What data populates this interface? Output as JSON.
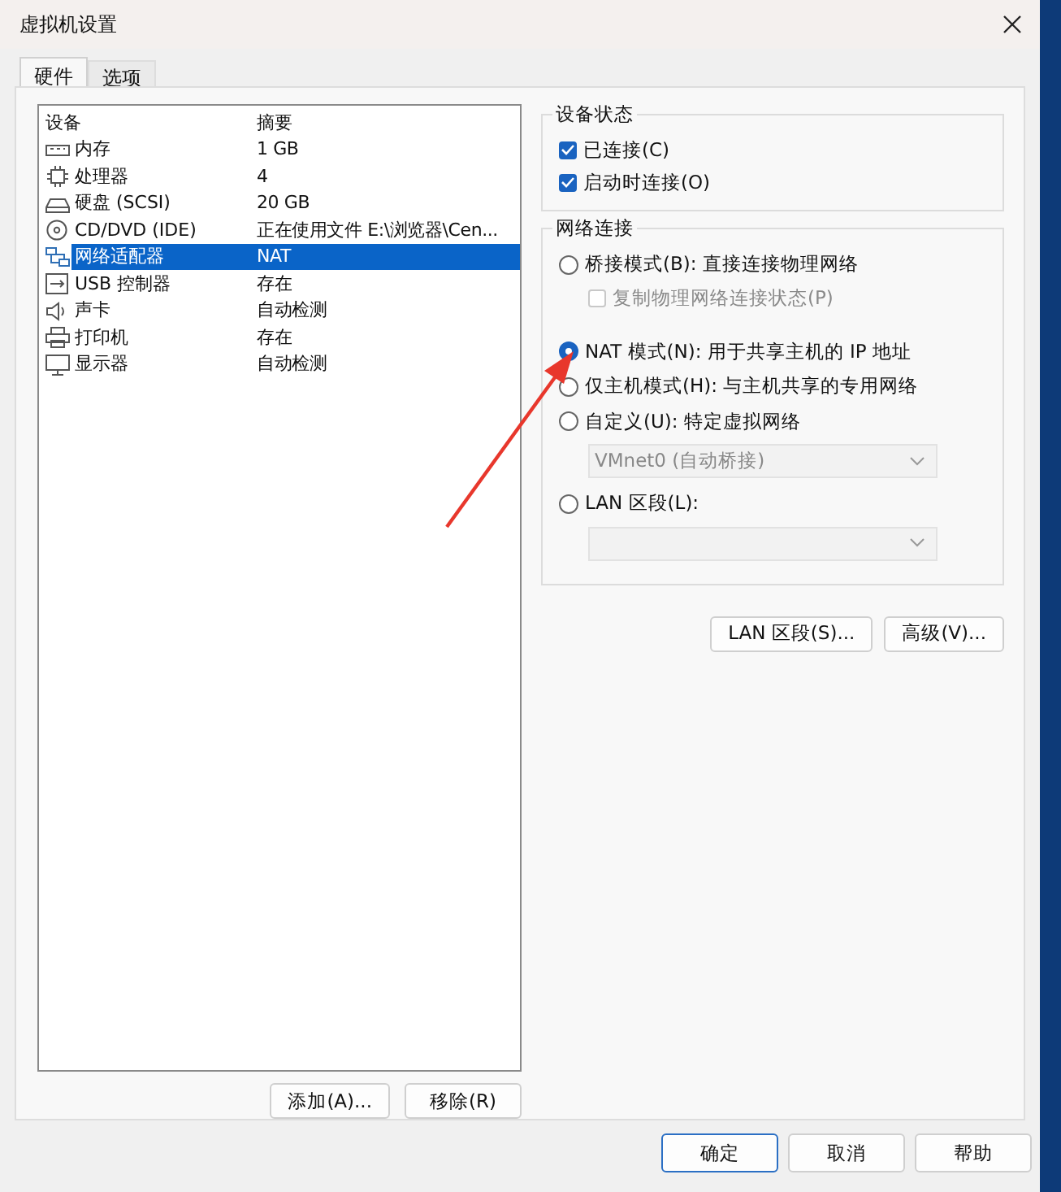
{
  "window": {
    "title": "虚拟机设置"
  },
  "tabs": [
    {
      "label": "硬件",
      "selected": true
    },
    {
      "label": "选项",
      "selected": false
    }
  ],
  "device_table": {
    "columns": [
      "设备",
      "摘要"
    ],
    "rows": [
      {
        "kind": "memory",
        "device": "内存",
        "summary": "1 GB",
        "selected": false
      },
      {
        "kind": "cpu",
        "device": "处理器",
        "summary": "4",
        "selected": false
      },
      {
        "kind": "disk",
        "device": "硬盘 (SCSI)",
        "summary": "20 GB",
        "selected": false
      },
      {
        "kind": "cd",
        "device": "CD/DVD (IDE)",
        "summary": "正在使用文件 E:\\浏览器\\Cen...",
        "selected": false
      },
      {
        "kind": "network",
        "device": "网络适配器",
        "summary": "NAT",
        "selected": true
      },
      {
        "kind": "usb",
        "device": "USB 控制器",
        "summary": "存在",
        "selected": false
      },
      {
        "kind": "sound",
        "device": "声卡",
        "summary": "自动检测",
        "selected": false
      },
      {
        "kind": "printer",
        "device": "打印机",
        "summary": "存在",
        "selected": false
      },
      {
        "kind": "display",
        "device": "显示器",
        "summary": "自动检测",
        "selected": false
      }
    ]
  },
  "list_buttons": [
    "添加(A)...",
    "移除(R)"
  ],
  "device_status": {
    "title": "设备状态",
    "options": [
      {
        "label": "已连接(C)",
        "checked": true
      },
      {
        "label": "启动时连接(O)",
        "checked": true
      }
    ]
  },
  "network_connection": {
    "title": "网络连接",
    "options": [
      {
        "kind": "radio",
        "label": "桥接模式(B): 直接连接物理网络",
        "selected": false
      },
      {
        "kind": "checkbox",
        "label": "复制物理网络连接状态(P)",
        "checked": false,
        "disabled": true
      },
      {
        "kind": "radio",
        "label": "NAT 模式(N): 用于共享主机的 IP 地址",
        "selected": true
      },
      {
        "kind": "radio",
        "label": "仅主机模式(H): 与主机共享的专用网络",
        "selected": false
      },
      {
        "kind": "radio",
        "label": "自定义(U): 特定虚拟网络",
        "selected": false
      },
      {
        "kind": "dropdown",
        "value": "VMnet0 (自动桥接)",
        "disabled": true
      },
      {
        "kind": "radio",
        "label": "LAN 区段(L):",
        "selected": false
      },
      {
        "kind": "dropdown",
        "disabled": true
      }
    ]
  },
  "network_buttons": [
    "LAN 区段(S)...",
    "高级(V)..."
  ],
  "dialog_buttons": [
    "确定",
    "取消",
    "帮助"
  ]
}
